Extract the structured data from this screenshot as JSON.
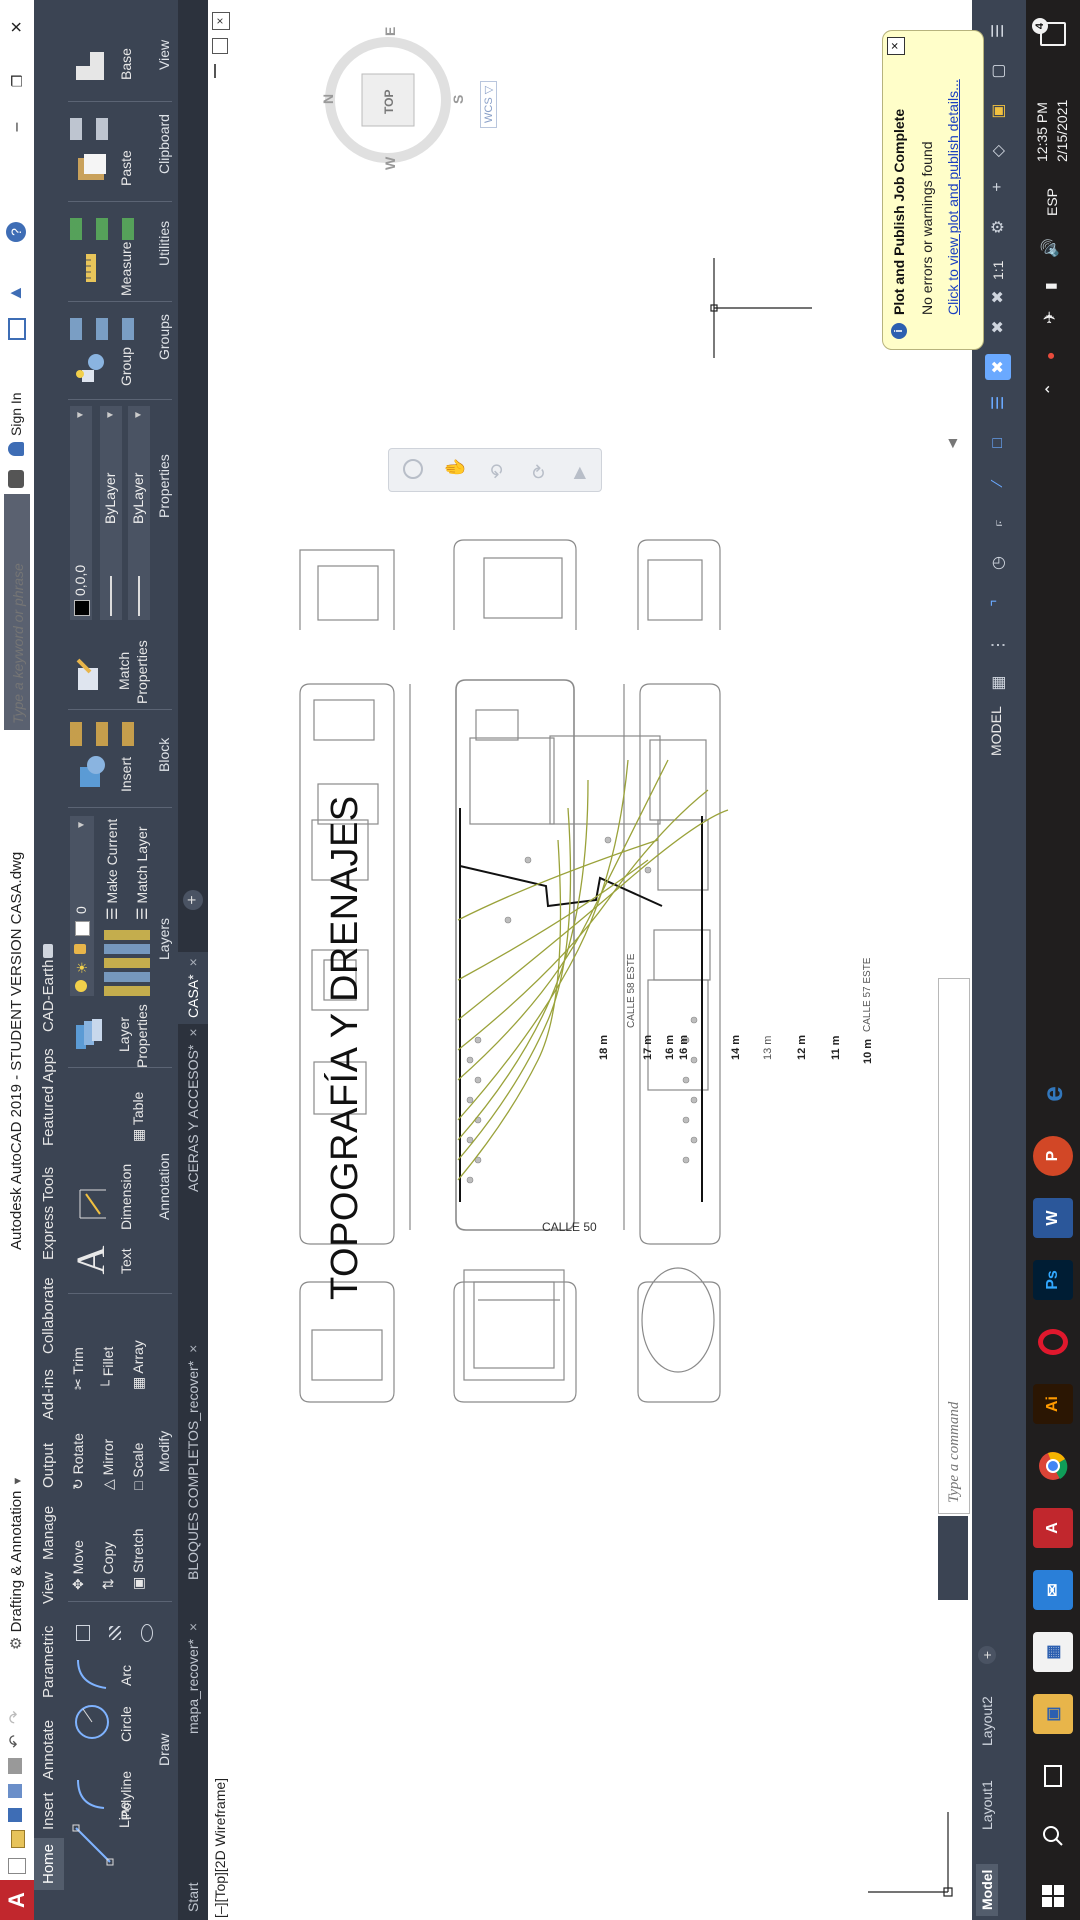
{
  "window": {
    "title": "Autodesk AutoCAD 2019 - STUDENT VERSION    CASA.dwg",
    "workspace": "Drafting & Annotation",
    "search_placeholder": "Type a keyword or phrase",
    "sign_in": "Sign In"
  },
  "ribbon_tabs": [
    "Home",
    "Insert",
    "Annotate",
    "Parametric",
    "View",
    "Manage",
    "Output",
    "Add-ins",
    "Collaborate",
    "Express Tools",
    "Featured Apps",
    "CAD-Earth"
  ],
  "ribbon": {
    "draw": {
      "line": "Line",
      "polyline": "Polyline",
      "circle": "Circle",
      "arc": "Arc",
      "title": "Draw"
    },
    "modify": {
      "move": "Move",
      "rotate": "Rotate",
      "trim": "Trim",
      "copy": "Copy",
      "mirror": "Mirror",
      "fillet": "Fillet",
      "stretch": "Stretch",
      "scale": "Scale",
      "array": "Array",
      "title": "Modify"
    },
    "annotation": {
      "text": "Text",
      "dimension": "Dimension",
      "table": "Table",
      "title": "Annotation"
    },
    "layers": {
      "layer_properties_1": "Layer",
      "layer_properties_2": "Properties",
      "current_layer": "0",
      "make_current": "Make Current",
      "match_layer": "Match Layer",
      "title": "Layers"
    },
    "block": {
      "insert": "Insert",
      "title": "Block"
    },
    "properties": {
      "match_1": "Match",
      "match_2": "Properties",
      "color": "0,0,0",
      "linetype": "ByLayer",
      "lineweight": "ByLayer",
      "title": "Properties"
    },
    "groups": {
      "group": "Group",
      "title": "Groups"
    },
    "utilities": {
      "measure": "Measure",
      "title": "Utilities"
    },
    "clipboard": {
      "paste": "Paste",
      "title": "Clipboard"
    },
    "view": {
      "base": "Base",
      "title": "View"
    }
  },
  "file_tabs": [
    "Start",
    "mapa_recover*",
    "BLOQUES COMPLETOS_recover*",
    "ACERAS Y ACCESOS*",
    "CASA*"
  ],
  "viewport": {
    "label": "[–][Top][2D Wireframe]",
    "viewcube": {
      "top": "TOP",
      "north": "N",
      "south": "S",
      "east": "E",
      "west": "W",
      "wcs": "WCS"
    }
  },
  "drawing": {
    "title": "TOPOGRAFÍA Y DRENAJES",
    "contours": [
      "18 m",
      "17 m",
      "16 m",
      "16 m",
      "14 m",
      "13 m",
      "12 m",
      "11 m",
      "10 m"
    ],
    "street_bottom": "CALLE 50",
    "street_left": "CALLE 58 ESTE",
    "street_right": "CALLE 57 ESTE"
  },
  "command_line": {
    "placeholder": "Type a command"
  },
  "layout_tabs": [
    "Model",
    "Layout1",
    "Layout2"
  ],
  "status_bar": {
    "model": "MODEL",
    "scale": "1:1"
  },
  "notification": {
    "title": "Plot and Publish Job Complete",
    "line1": "No errors or warnings found",
    "link": "Click to view plot and publish details..."
  },
  "taskbar": {
    "apps": [
      "Start",
      "Search",
      "Task View",
      "File Explorer",
      "Store",
      "Mail",
      "AutoCAD",
      "Chrome",
      "Illustrator",
      "Opera",
      "Photoshop",
      "Word",
      "PowerPoint",
      "Edge"
    ],
    "time": "12:35 PM",
    "date": "2/15/2021",
    "language": "ESP",
    "notification_count": "4"
  },
  "colors": {
    "ribbon": "#3b4453",
    "taskbar": "#201e1e",
    "contour": "#9aa23a",
    "notification": "#fffec9",
    "autocad_red": "#c1272d"
  }
}
